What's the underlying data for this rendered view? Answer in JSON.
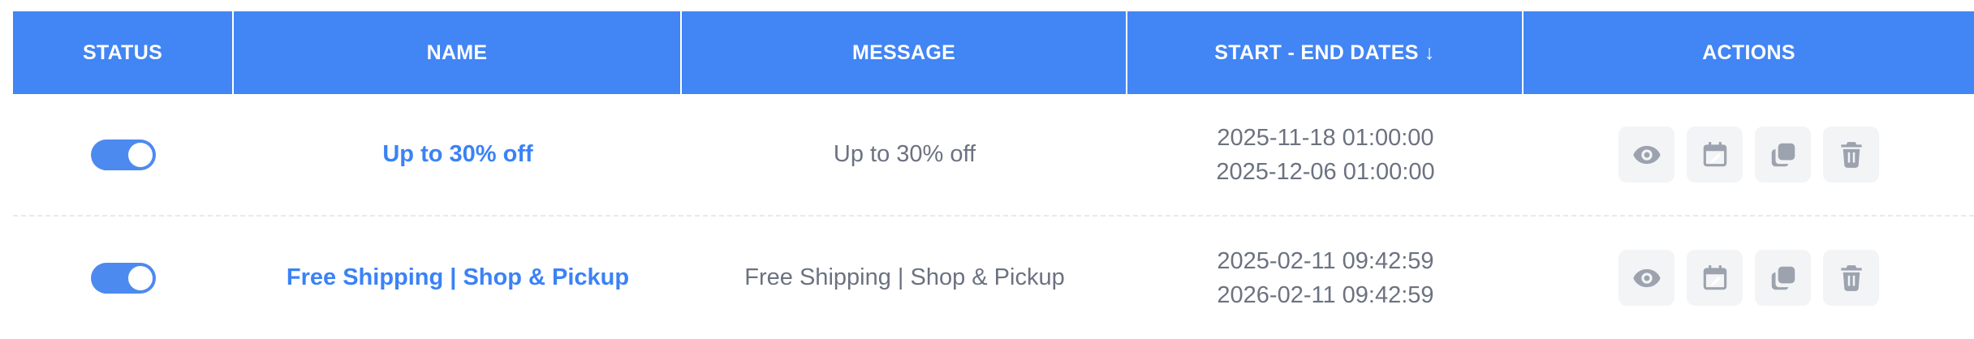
{
  "table": {
    "headers": {
      "status": "STATUS",
      "name": "NAME",
      "message": "MESSAGE",
      "dates": "START - END DATES ↓",
      "actions": "ACTIONS"
    },
    "rows": [
      {
        "status_enabled": true,
        "name": "Up to 30% off",
        "message": "Up to 30% off",
        "start": "2025-11-18 01:00:00",
        "end": "2025-12-06 01:00:00"
      },
      {
        "status_enabled": true,
        "name": "Free Shipping | Shop & Pickup",
        "message": "Free Shipping | Shop & Pickup",
        "start": "2025-02-11 09:42:59",
        "end": "2026-02-11 09:42:59"
      }
    ],
    "action_icons": [
      "eye-icon",
      "calendar-edit-icon",
      "duplicate-icon",
      "trash-icon"
    ]
  },
  "colors": {
    "header_bg": "#4285f4",
    "accent": "#3b82f6",
    "toggle_on": "#4d8af0",
    "icon": "#9ca3af",
    "action_bg": "#f3f4f6"
  }
}
